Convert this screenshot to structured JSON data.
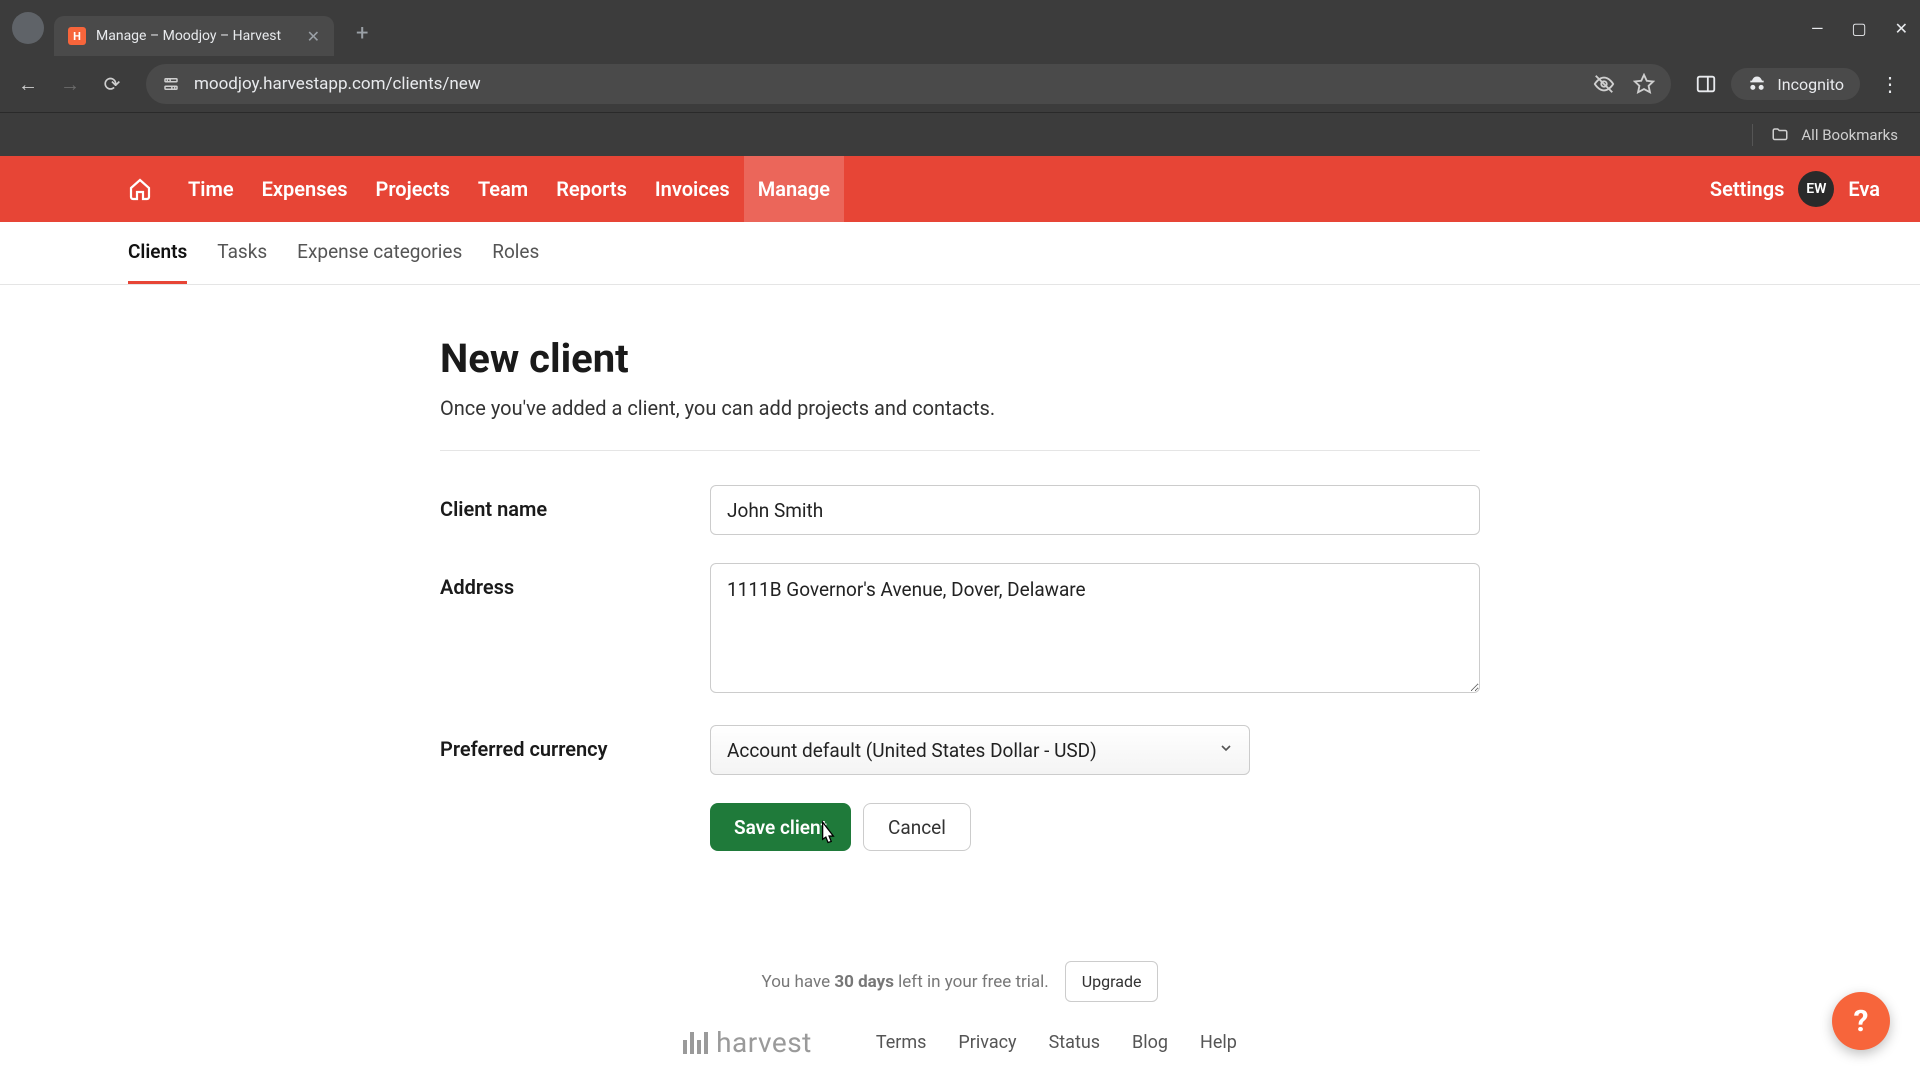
{
  "browser": {
    "tab_title": "Manage – Moodjoy – Harvest",
    "url": "moodjoy.harvestapp.com/clients/new",
    "incognito_label": "Incognito",
    "all_bookmarks": "All Bookmarks"
  },
  "app_nav": {
    "items": [
      "Time",
      "Expenses",
      "Projects",
      "Team",
      "Reports",
      "Invoices",
      "Manage"
    ],
    "active_index": 6,
    "settings": "Settings",
    "user_initials": "EW",
    "user_name": "Eva"
  },
  "subtabs": {
    "items": [
      "Clients",
      "Tasks",
      "Expense categories",
      "Roles"
    ],
    "active_index": 0
  },
  "page": {
    "title": "New client",
    "subtitle": "Once you've added a client, you can add projects and contacts."
  },
  "form": {
    "client_name_label": "Client name",
    "client_name_value": "John Smith",
    "address_label": "Address",
    "address_value": "1111B Governor's Avenue, Dover, Delaware",
    "currency_label": "Preferred currency",
    "currency_value": "Account default (United States Dollar - USD)",
    "save_label": "Save client",
    "cancel_label": "Cancel"
  },
  "footer": {
    "trial_prefix": "You have ",
    "trial_days": "30 days",
    "trial_suffix": " left in your free trial.",
    "upgrade": "Upgrade",
    "brand": "harvest",
    "links": [
      "Terms",
      "Privacy",
      "Status",
      "Blog",
      "Help"
    ]
  },
  "help_fab": "?"
}
